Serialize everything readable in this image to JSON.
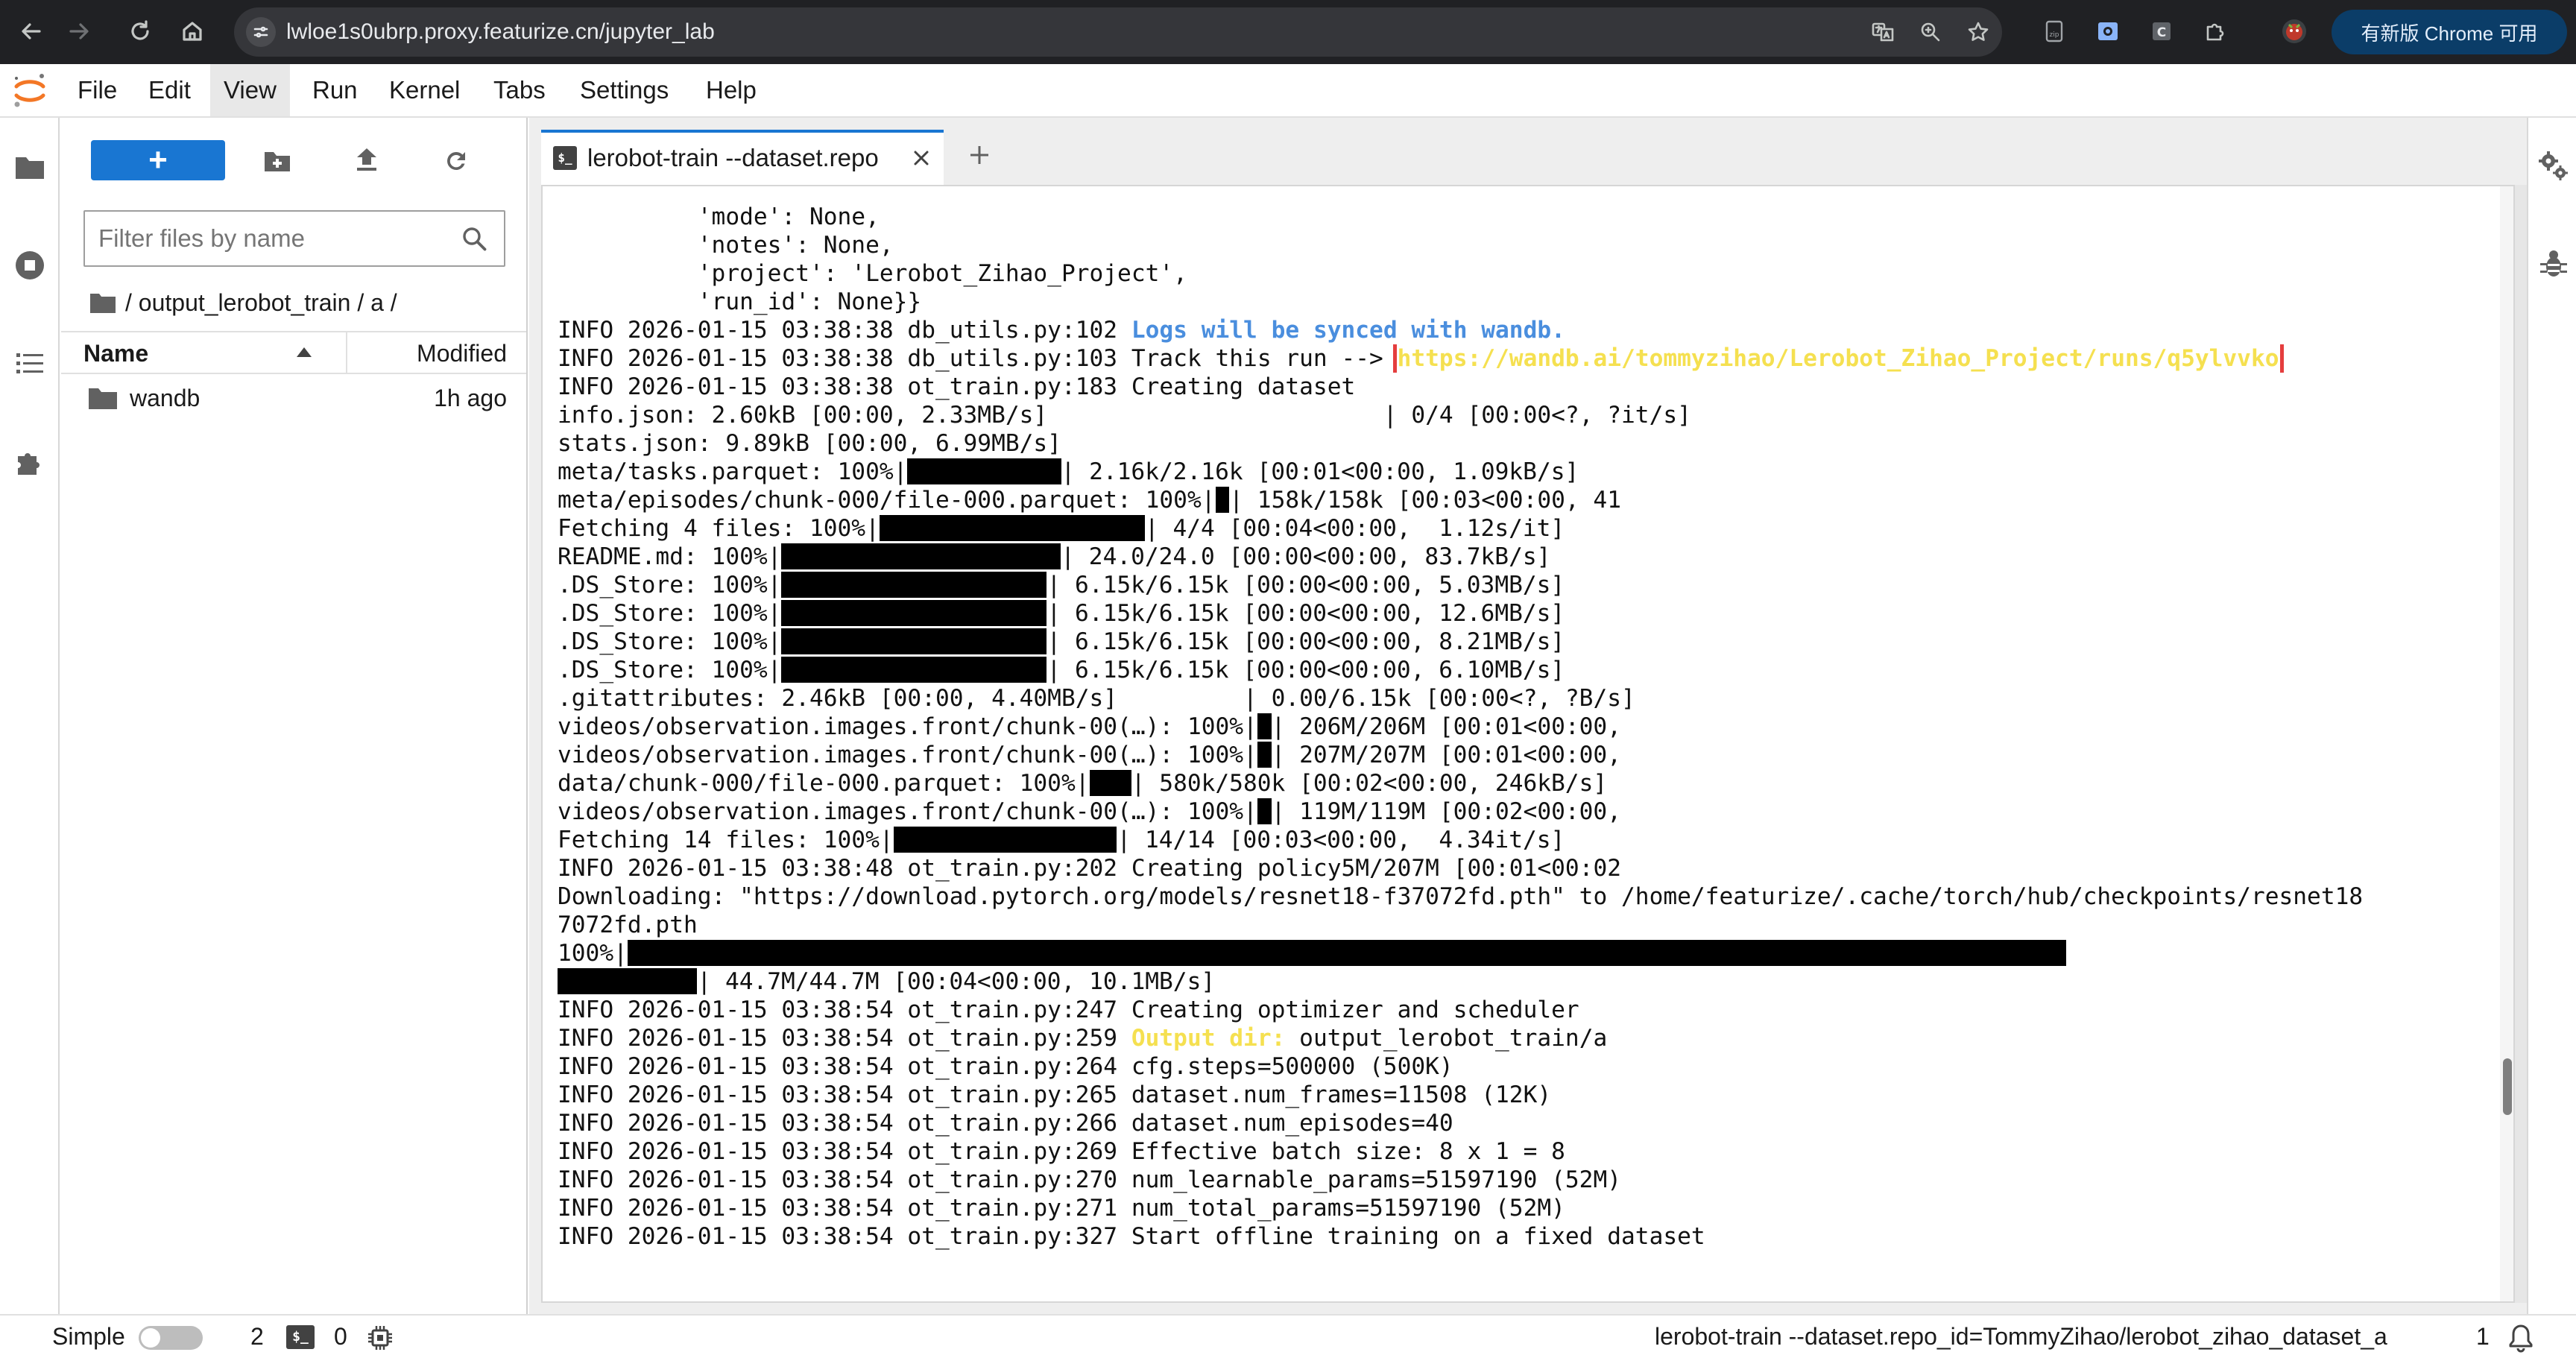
{
  "browser": {
    "url": "lwloe1s0ubrp.proxy.featurize.cn/jupyter_lab",
    "update_label": "有新版 Chrome 可用"
  },
  "menu": {
    "items": [
      "File",
      "Edit",
      "View",
      "Run",
      "Kernel",
      "Tabs",
      "Settings",
      "Help"
    ],
    "active": "View"
  },
  "file_browser": {
    "filter_placeholder": "Filter files by name",
    "breadcrumb": "/ output_lerobot_train / a /",
    "col_name": "Name",
    "col_modified": "Modified",
    "files": [
      {
        "name": "wandb",
        "modified": "1h ago",
        "type": "folder"
      }
    ]
  },
  "tab": {
    "label": "lerobot-train --dataset.repo",
    "term_icon": "$_"
  },
  "terminal": {
    "lines": [
      [
        {
          "t": "          'mode': None,"
        }
      ],
      [
        {
          "t": "          'notes': None,"
        }
      ],
      [
        {
          "t": "          'project': 'Lerobot_Zihao_Project',"
        }
      ],
      [
        {
          "t": "          'run_id': None}}"
        }
      ],
      [
        {
          "t": "INFO 2026-01-15 03:38:38 db_utils.py:102 "
        },
        {
          "t": "Logs will be synced with wandb.",
          "s": "blue"
        }
      ],
      [
        {
          "t": "INFO 2026-01-15 03:38:38 db_utils.py:103 Track this run --> "
        },
        {
          "t": "https://wandb.ai/tommyzihao/Lerobot_Zihao_Project/runs/q5ylvvko",
          "s": "link"
        }
      ],
      [
        {
          "t": "INFO 2026-01-15 03:38:38 ot_train.py:183 Creating dataset"
        }
      ],
      [
        {
          "t": "info.json: 2.60kB [00:00, 2.33MB/s]                        | 0/4 [00:00<?, ?it/s]"
        }
      ],
      [
        {
          "t": "stats.json: 9.89kB [00:00, 6.99MB/s]"
        }
      ],
      [
        {
          "t": "meta/tasks.parquet: 100%|"
        },
        {
          "b": 11
        },
        {
          "t": "| 2.16k/2.16k [00:01<00:00, 1.09kB/s]"
        }
      ],
      [
        {
          "t": "meta/episodes/chunk-000/file-000.parquet: 100%|"
        },
        {
          "b": 1
        },
        {
          "t": "| 158k/158k [00:03<00:00, 41"
        }
      ],
      [
        {
          "t": "Fetching 4 files: 100%|"
        },
        {
          "b": 19
        },
        {
          "t": "| 4/4 [00:04<00:00,  1.12s/it]"
        }
      ],
      [
        {
          "t": "README.md: 100%|"
        },
        {
          "b": 20
        },
        {
          "t": "| 24.0/24.0 [00:00<00:00, 83.7kB/s]"
        }
      ],
      [
        {
          "t": ".DS_Store: 100%|"
        },
        {
          "b": 19
        },
        {
          "t": "| 6.15k/6.15k [00:00<00:00, 5.03MB/s]"
        }
      ],
      [
        {
          "t": ".DS_Store: 100%|"
        },
        {
          "b": 19
        },
        {
          "t": "| 6.15k/6.15k [00:00<00:00, 12.6MB/s]"
        }
      ],
      [
        {
          "t": ".DS_Store: 100%|"
        },
        {
          "b": 19
        },
        {
          "t": "| 6.15k/6.15k [00:00<00:00, 8.21MB/s]"
        }
      ],
      [
        {
          "t": ".DS_Store: 100%|"
        },
        {
          "b": 19
        },
        {
          "t": "| 6.15k/6.15k [00:00<00:00, 6.10MB/s]"
        }
      ],
      [
        {
          "t": ".gitattributes: 2.46kB [00:00, 4.40MB/s]         | 0.00/6.15k [00:00<?, ?B/s]"
        }
      ],
      [
        {
          "t": "videos/observation.images.front/chunk-00(…): 100%|"
        },
        {
          "b": 1
        },
        {
          "t": "| 206M/206M [00:01<00:00,"
        }
      ],
      [
        {
          "t": "videos/observation.images.front/chunk-00(…): 100%|"
        },
        {
          "b": 1
        },
        {
          "t": "| 207M/207M [00:01<00:00,"
        }
      ],
      [
        {
          "t": "data/chunk-000/file-000.parquet: 100%|"
        },
        {
          "b": 3
        },
        {
          "t": "| 580k/580k [00:02<00:00, 246kB/s]"
        }
      ],
      [
        {
          "t": "videos/observation.images.front/chunk-00(…): 100%|"
        },
        {
          "b": 1
        },
        {
          "t": "| 119M/119M [00:02<00:00,"
        }
      ],
      [
        {
          "t": "Fetching 14 files: 100%|"
        },
        {
          "b": 16
        },
        {
          "t": "| 14/14 [00:03<00:00,  4.34it/s]"
        }
      ],
      [
        {
          "t": "INFO 2026-01-15 03:38:48 ot_train.py:202 Creating policy5M/207M [00:01<00:02"
        }
      ],
      [
        {
          "t": "Downloading: \"https://download.pytorch.org/models/resnet18-f37072fd.pth\" to /home/featurize/.cache/torch/hub/checkpoints/resnet18-f3"
        }
      ],
      [
        {
          "t": "7072fd.pth"
        }
      ],
      [
        {
          "t": "100%|"
        },
        {
          "b": 103
        }
      ],
      [
        {
          "b": 10
        },
        {
          "t": "| 44.7M/44.7M [00:04<00:00, 10.1MB/s]"
        }
      ],
      [
        {
          "t": "INFO 2026-01-15 03:38:54 ot_train.py:247 Creating optimizer and scheduler"
        }
      ],
      [
        {
          "t": "INFO 2026-01-15 03:38:54 ot_train.py:259 "
        },
        {
          "t": "Output dir:",
          "s": "yellow"
        },
        {
          "t": " output_lerobot_train/a"
        }
      ],
      [
        {
          "t": "INFO 2026-01-15 03:38:54 ot_train.py:264 cfg.steps=500000 (500K)"
        }
      ],
      [
        {
          "t": "INFO 2026-01-15 03:38:54 ot_train.py:265 dataset.num_frames=11508 (12K)"
        }
      ],
      [
        {
          "t": "INFO 2026-01-15 03:38:54 ot_train.py:266 dataset.num_episodes=40"
        }
      ],
      [
        {
          "t": "INFO 2026-01-15 03:38:54 ot_train.py:269 Effective batch size: 8 x 1 = 8"
        }
      ],
      [
        {
          "t": "INFO 2026-01-15 03:38:54 ot_train.py:270 num_learnable_params=51597190 (52M)"
        }
      ],
      [
        {
          "t": "INFO 2026-01-15 03:38:54 ot_train.py:271 num_total_params=51597190 (52M)"
        }
      ],
      [
        {
          "t": "INFO 2026-01-15 03:38:54 ot_train.py:327 Start offline training on a fixed dataset"
        }
      ]
    ]
  },
  "status_bar": {
    "mode_label": "Simple",
    "terminals_count": "2",
    "term_icon": "$_",
    "kernels_count": "0",
    "current_item": "lerobot-train --dataset.repo_id=TommyZihao/lerobot_zihao_dataset_a",
    "notifications_count": "1"
  }
}
